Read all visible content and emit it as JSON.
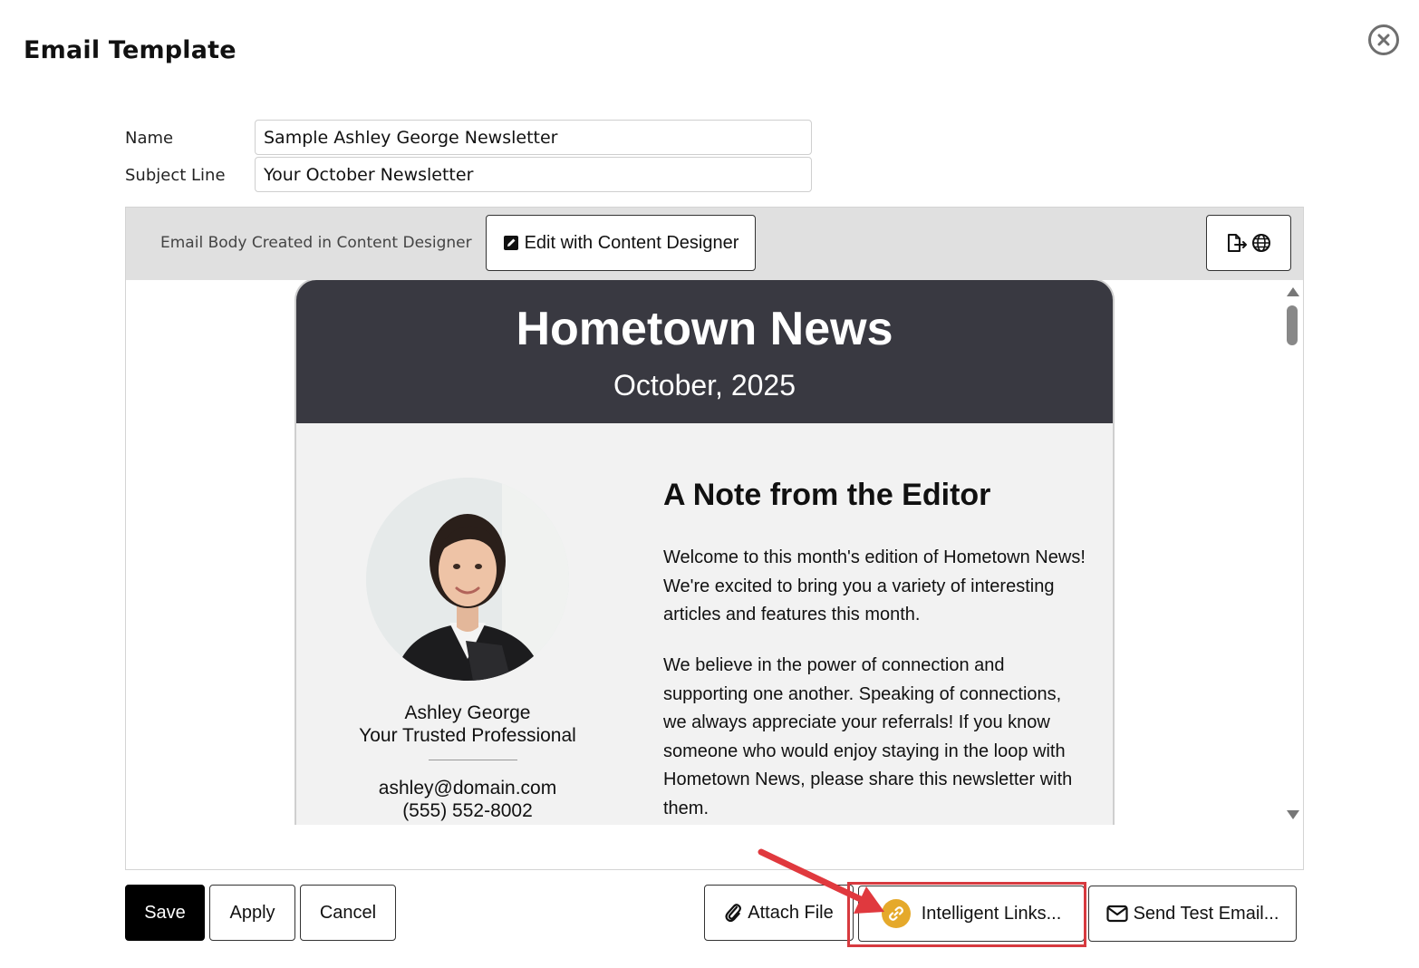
{
  "dialog": {
    "title": "Email Template"
  },
  "form": {
    "name_label": "Name",
    "name_value": "Sample Ashley George Newsletter",
    "subject_label": "Subject Line",
    "subject_value": "Your October Newsletter"
  },
  "editor": {
    "toolbar_label": "Email Body Created in Content Designer",
    "edit_button_label": "Edit with Content Designer",
    "export_icon": "export-web-icon"
  },
  "newsletter": {
    "title": "Hometown News",
    "date": "October, 2025",
    "person_name": "Ashley George",
    "person_role": "Your Trusted Professional",
    "email": "ashley@domain.com",
    "phone": "(555) 552-8002",
    "heading": "A Note from the Editor",
    "paragraph1": "Welcome to this month's edition of Hometown News! We're excited to bring you a variety of interesting articles and features this month.",
    "paragraph2": "We believe in the power of connection and supporting one another. Speaking of connections, we always appreciate your referrals! If you know someone who would enjoy staying in the loop with Hometown News, please share this newsletter with them."
  },
  "actions": {
    "save": "Save",
    "apply": "Apply",
    "cancel": "Cancel",
    "attach_file": "Attach File",
    "intelligent_links": "Intelligent Links...",
    "send_test_email": "Send Test Email..."
  },
  "colors": {
    "header_bg": "#393941",
    "highlight": "#d73a3f",
    "link_badge": "#e5a92b"
  }
}
